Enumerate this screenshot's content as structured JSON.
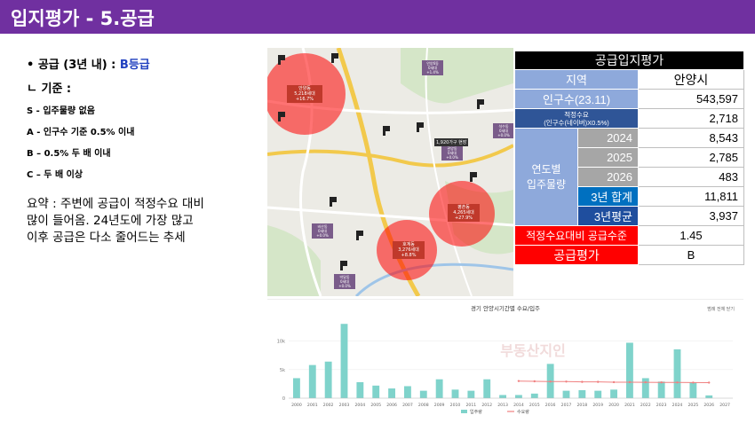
{
  "header": {
    "title": "입지평가 - 5.공급"
  },
  "left": {
    "supply_line": "•   공급 (3년 내) : ",
    "supply_grade": "B등급",
    "criteria_title": "ㄴ 기준 :",
    "criteria": [
      "S - 입주물량 없음",
      "A - 인구수 기준 0.5% 이내",
      " B – 0.5% 두 배 이내",
      "C – 두 배 이상"
    ],
    "summary_lines": [
      "요약 : 주변에 공급이 적정수요 대비",
      "많이 들어옴. 24년도에 가장 많고",
      "이후 공급은 다소 줄어드는 추세"
    ]
  },
  "map": {
    "bubbles": [
      {
        "lines": [
          "안양동",
          "5,218세대",
          "+16.7%"
        ]
      },
      {
        "lines": [
          "평촌동",
          "4,265세대",
          "+27.9%"
        ]
      },
      {
        "lines": [
          "호계동",
          "3,276세대",
          "+8.8%"
        ]
      }
    ],
    "badges": [
      {
        "lines": [
          "안양6동",
          "0세대",
          "+1.4%"
        ]
      },
      {
        "lines": [
          "석수동",
          "0세대",
          "+0.0%"
        ]
      },
      {
        "lines": [
          "박달동",
          "0세대",
          "+0.0%"
        ]
      },
      {
        "lines": [
          "관양동",
          "0세대",
          "+0.0%"
        ]
      },
      {
        "lines": [
          "비산동",
          "0세대",
          "+0.0%"
        ]
      }
    ],
    "center_label": "1,920가구 현장"
  },
  "table": {
    "title": "공급입지평가",
    "region_label": "지역",
    "region_value": "안양시",
    "population_label": "인구수(23.11)",
    "population_value": "543,597",
    "demand_label_1": "적정수요",
    "demand_label_2": "(인구수(네이버)X0.5%)",
    "demand_value": "2,718",
    "yearly_label_1": "연도별",
    "yearly_label_2": "입주물량",
    "years": [
      {
        "year": "2024",
        "value": "8,543"
      },
      {
        "year": "2025",
        "value": "2,785"
      },
      {
        "year": "2026",
        "value": "483"
      }
    ],
    "sum_label": "3년 합계",
    "sum_value": "11,811",
    "avg_label": "3년평균",
    "avg_value": "3,937",
    "ratio_label": "적정수요대비 공급수준",
    "ratio_value": "1.45",
    "grade_label": "공급평가",
    "grade_value": "B"
  },
  "chart_data": {
    "type": "bar",
    "title": "경기 안양시기간별 수요/입주",
    "toolbar": "범례 전체 닫기",
    "watermark": "부동산지인",
    "categories": [
      "2000",
      "2001",
      "2002",
      "2003",
      "2004",
      "2005",
      "2006",
      "2007",
      "2008",
      "2009",
      "2010",
      "2011",
      "2012",
      "2013",
      "2014",
      "2015",
      "2016",
      "2017",
      "2018",
      "2019",
      "2020",
      "2021",
      "2022",
      "2023",
      "2024",
      "2025",
      "2026",
      "2027"
    ],
    "series": [
      {
        "name": "입주량",
        "values": [
          3500,
          5800,
          6400,
          13000,
          2800,
          2200,
          1700,
          2100,
          1300,
          3300,
          1500,
          1300,
          3300,
          553,
          553,
          800,
          6000,
          1300,
          1400,
          1300,
          1500,
          9700,
          3500,
          2900,
          8543,
          2785,
          483,
          0
        ],
        "color": "#7fd3cb"
      },
      {
        "name": "수요량",
        "values": [
          null,
          null,
          null,
          null,
          null,
          null,
          null,
          null,
          null,
          null,
          null,
          null,
          null,
          null,
          3000,
          2950,
          2900,
          2900,
          2850,
          2850,
          2800,
          2800,
          2780,
          2760,
          2750,
          2730,
          2718,
          null
        ],
        "color": "#f08080"
      }
    ],
    "ylim": [
      0,
      13500
    ],
    "yticks": [
      0,
      5000,
      10000
    ],
    "ytick_labels": [
      "0",
      "5k",
      "10k"
    ]
  }
}
